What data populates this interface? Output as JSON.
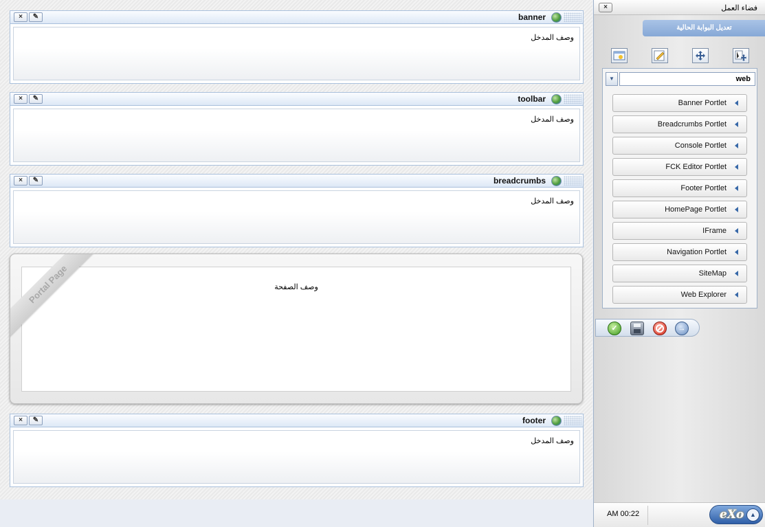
{
  "colors": {
    "accent": "#86a8d6",
    "portlet_border": "#a9c0dc",
    "list_arrow": "#3768a8"
  },
  "main": {
    "portlets": [
      {
        "title": "banner",
        "description": "وصف المدخل"
      },
      {
        "title": "toolbar",
        "description": "وصف المدخل"
      },
      {
        "title": "breadcrumbs",
        "description": "وصف المدخل"
      },
      {
        "title": "footer",
        "description": "وصف المدخل"
      }
    ],
    "portal_page": {
      "ribbon_label": "Portal Page",
      "description": "وصف الصفحة"
    }
  },
  "workspace": {
    "title": "فضاء العمل",
    "close_label": "×",
    "edit_page_label": "تعديل البوابة الحالية",
    "tools": [
      "page-info-icon",
      "edit-icon",
      "move-icon",
      "layout-icon"
    ],
    "category_select": {
      "value": "web",
      "arrow": "▼"
    },
    "portlet_items": [
      "Banner Portlet",
      "Breadcrumbs Portlet",
      "Console Portlet",
      "FCK Editor Portlet",
      "Footer Portlet",
      "HomePage Portlet",
      "IFrame",
      "Navigation Portlet",
      "SiteMap",
      "Web Explorer"
    ],
    "actions": {
      "confirm": "✓",
      "next": "→"
    }
  },
  "taskbar": {
    "clock": "AM 00:22",
    "logo": "eXo",
    "up_arrow": "▲"
  }
}
